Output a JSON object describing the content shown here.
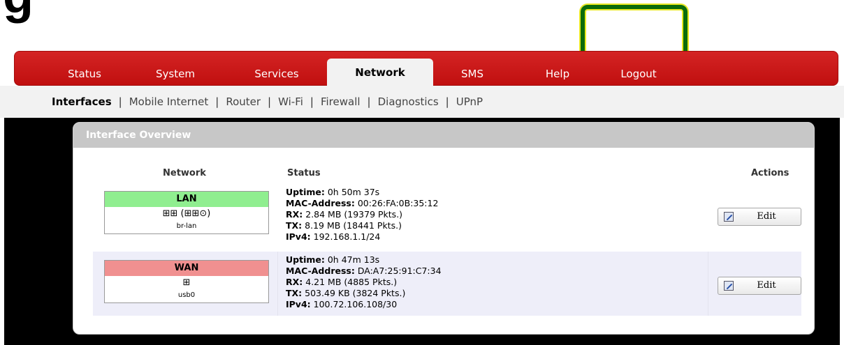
{
  "top_fragment": "g",
  "nav": {
    "tabs": [
      "Status",
      "System",
      "Services",
      "Network",
      "SMS",
      "Help",
      "Logout"
    ],
    "active": "Network"
  },
  "subnav": {
    "links": [
      "Interfaces",
      "Mobile Internet",
      "Router",
      "Wi-Fi",
      "Firewall",
      "Diagnostics",
      "UPnP"
    ],
    "active": "Interfaces"
  },
  "panel": {
    "title": "Interface Overview",
    "headers": {
      "network": "Network",
      "status": "Status",
      "actions": "Actions"
    },
    "rows": [
      {
        "name": "LAN",
        "name_color": "#90ee90",
        "icons": "⊞⊞ (⊞⊞⊙)",
        "device": "br-lan",
        "uptime_label": "Uptime:",
        "uptime": "0h 50m 37s",
        "mac_label": "MAC-Address:",
        "mac": "00:26:FA:0B:35:12",
        "rx_label": "RX:",
        "rx": "2.84 MB (19379 Pkts.)",
        "tx_label": "TX:",
        "tx": "8.19 MB (18441 Pkts.)",
        "ipv4_label": "IPv4:",
        "ipv4": "192.168.1.1/24",
        "action": "Edit"
      },
      {
        "name": "WAN",
        "name_color": "#f09090",
        "icons": "⊞",
        "device": "usb0",
        "uptime_label": "Uptime:",
        "uptime": "0h 47m 13s",
        "mac_label": "MAC-Address:",
        "mac": "DA:A7:25:91:C7:34",
        "rx_label": "RX:",
        "rx": "4.21 MB (4885 Pkts.)",
        "tx_label": "TX:",
        "tx": "503.49 KB (3824 Pkts.)",
        "ipv4_label": "IPv4:",
        "ipv4": "100.72.106.108/30",
        "action": "Edit"
      }
    ]
  },
  "colors": {
    "nav_red": "#c00f0f",
    "highlight_green": "#0b6b0b",
    "highlight_yellow": "#e8e820"
  }
}
